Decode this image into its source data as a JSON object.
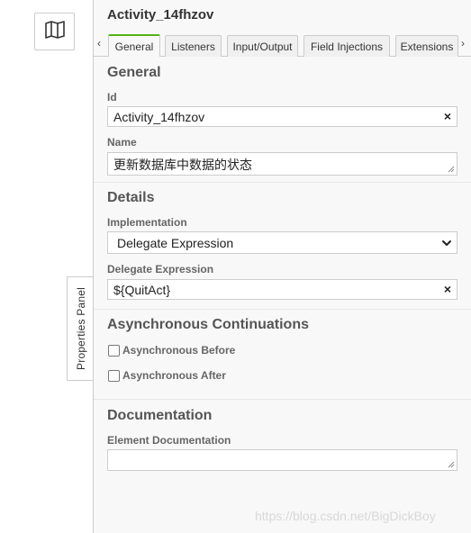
{
  "sidebar": {
    "map_icon": "map-icon",
    "toggle_label": "Properties Panel"
  },
  "panel": {
    "title": "Activity_14fhzov",
    "tabs": [
      {
        "label": "General",
        "active": true
      },
      {
        "label": "Listeners",
        "active": false
      },
      {
        "label": "Input/Output",
        "active": false
      },
      {
        "label": "Field Injections",
        "active": false
      },
      {
        "label": "Extensions",
        "active": false
      }
    ],
    "tab_prev": "‹",
    "tab_next": "›"
  },
  "general": {
    "title": "General",
    "id_label": "Id",
    "id_value": "Activity_14fhzov",
    "name_label": "Name",
    "name_value": "更新数据库中数据的状态"
  },
  "details": {
    "title": "Details",
    "implementation_label": "Implementation",
    "implementation_value": "Delegate Expression",
    "delegate_label": "Delegate Expression",
    "delegate_value": "${QuitAct}"
  },
  "async": {
    "title": "Asynchronous Continuations",
    "before_label": "Asynchronous Before",
    "before_checked": false,
    "after_label": "Asynchronous After",
    "after_checked": false
  },
  "documentation": {
    "title": "Documentation",
    "element_label": "Element Documentation",
    "element_value": ""
  },
  "watermark": "https://blog.csdn.net/BigDickBoy",
  "clear_glyph": "×",
  "colors": {
    "active_tab_accent": "#52b415",
    "panel_bg": "#f8f8f8",
    "border": "#cccccc"
  }
}
